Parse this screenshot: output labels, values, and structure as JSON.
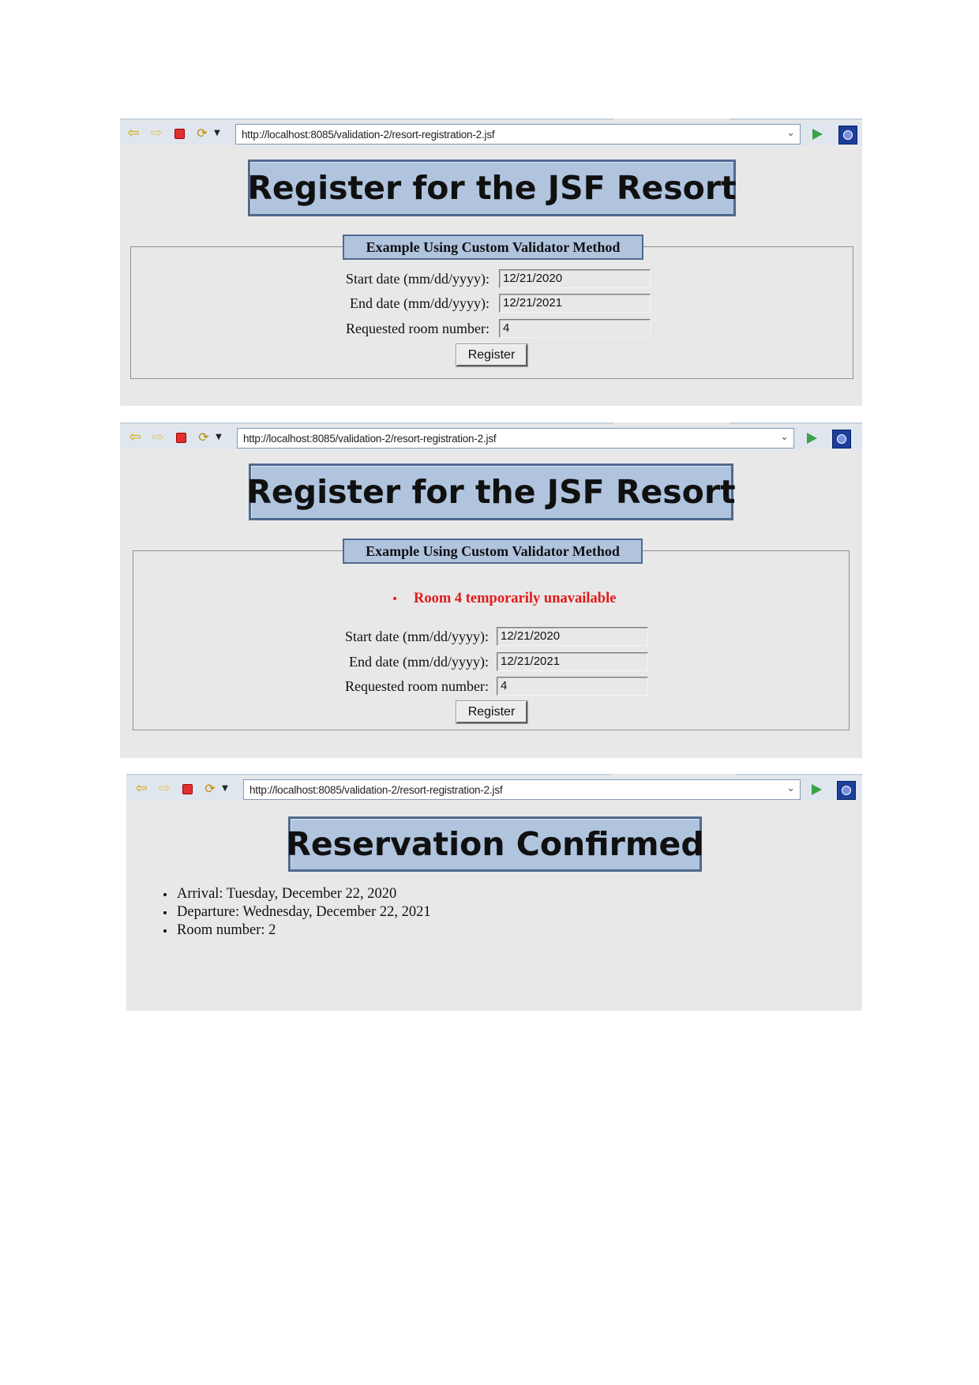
{
  "browser": {
    "url": "http://localhost:8085/validation-2/resort-registration-2.jsf",
    "icons": [
      "back-arrow-icon",
      "forward-arrow-icon",
      "stop-icon",
      "refresh-icon",
      "dropdown-caret-icon",
      "go-icon",
      "eclipse-icon"
    ]
  },
  "registration": {
    "title": "Register for the JSF Resort",
    "legend": "Example Using Custom Validator Method",
    "start_label": "Start date (mm/dd/yyyy):",
    "end_label": "End date (mm/dd/yyyy):",
    "room_label": "Requested room number:",
    "register_label": "Register"
  },
  "screen1": {
    "start_value": "12/21/2020",
    "end_value": "12/21/2021",
    "room_value": "4"
  },
  "screen2": {
    "error_message": "Room 4 temporarily unavailable",
    "start_value": "12/21/2020",
    "end_value": "12/21/2021",
    "room_value": "4"
  },
  "screen3": {
    "title": "Reservation Confirmed",
    "items": [
      "Arrival: Tuesday, December 22, 2020",
      "Departure: Wednesday, December 22, 2021",
      "Room number: 2"
    ]
  },
  "colors": {
    "heading_bg": "#b0c4de",
    "heading_border": "#4f6a8e",
    "error": "#e01a1a",
    "page_bg": "#e8e8e8"
  }
}
